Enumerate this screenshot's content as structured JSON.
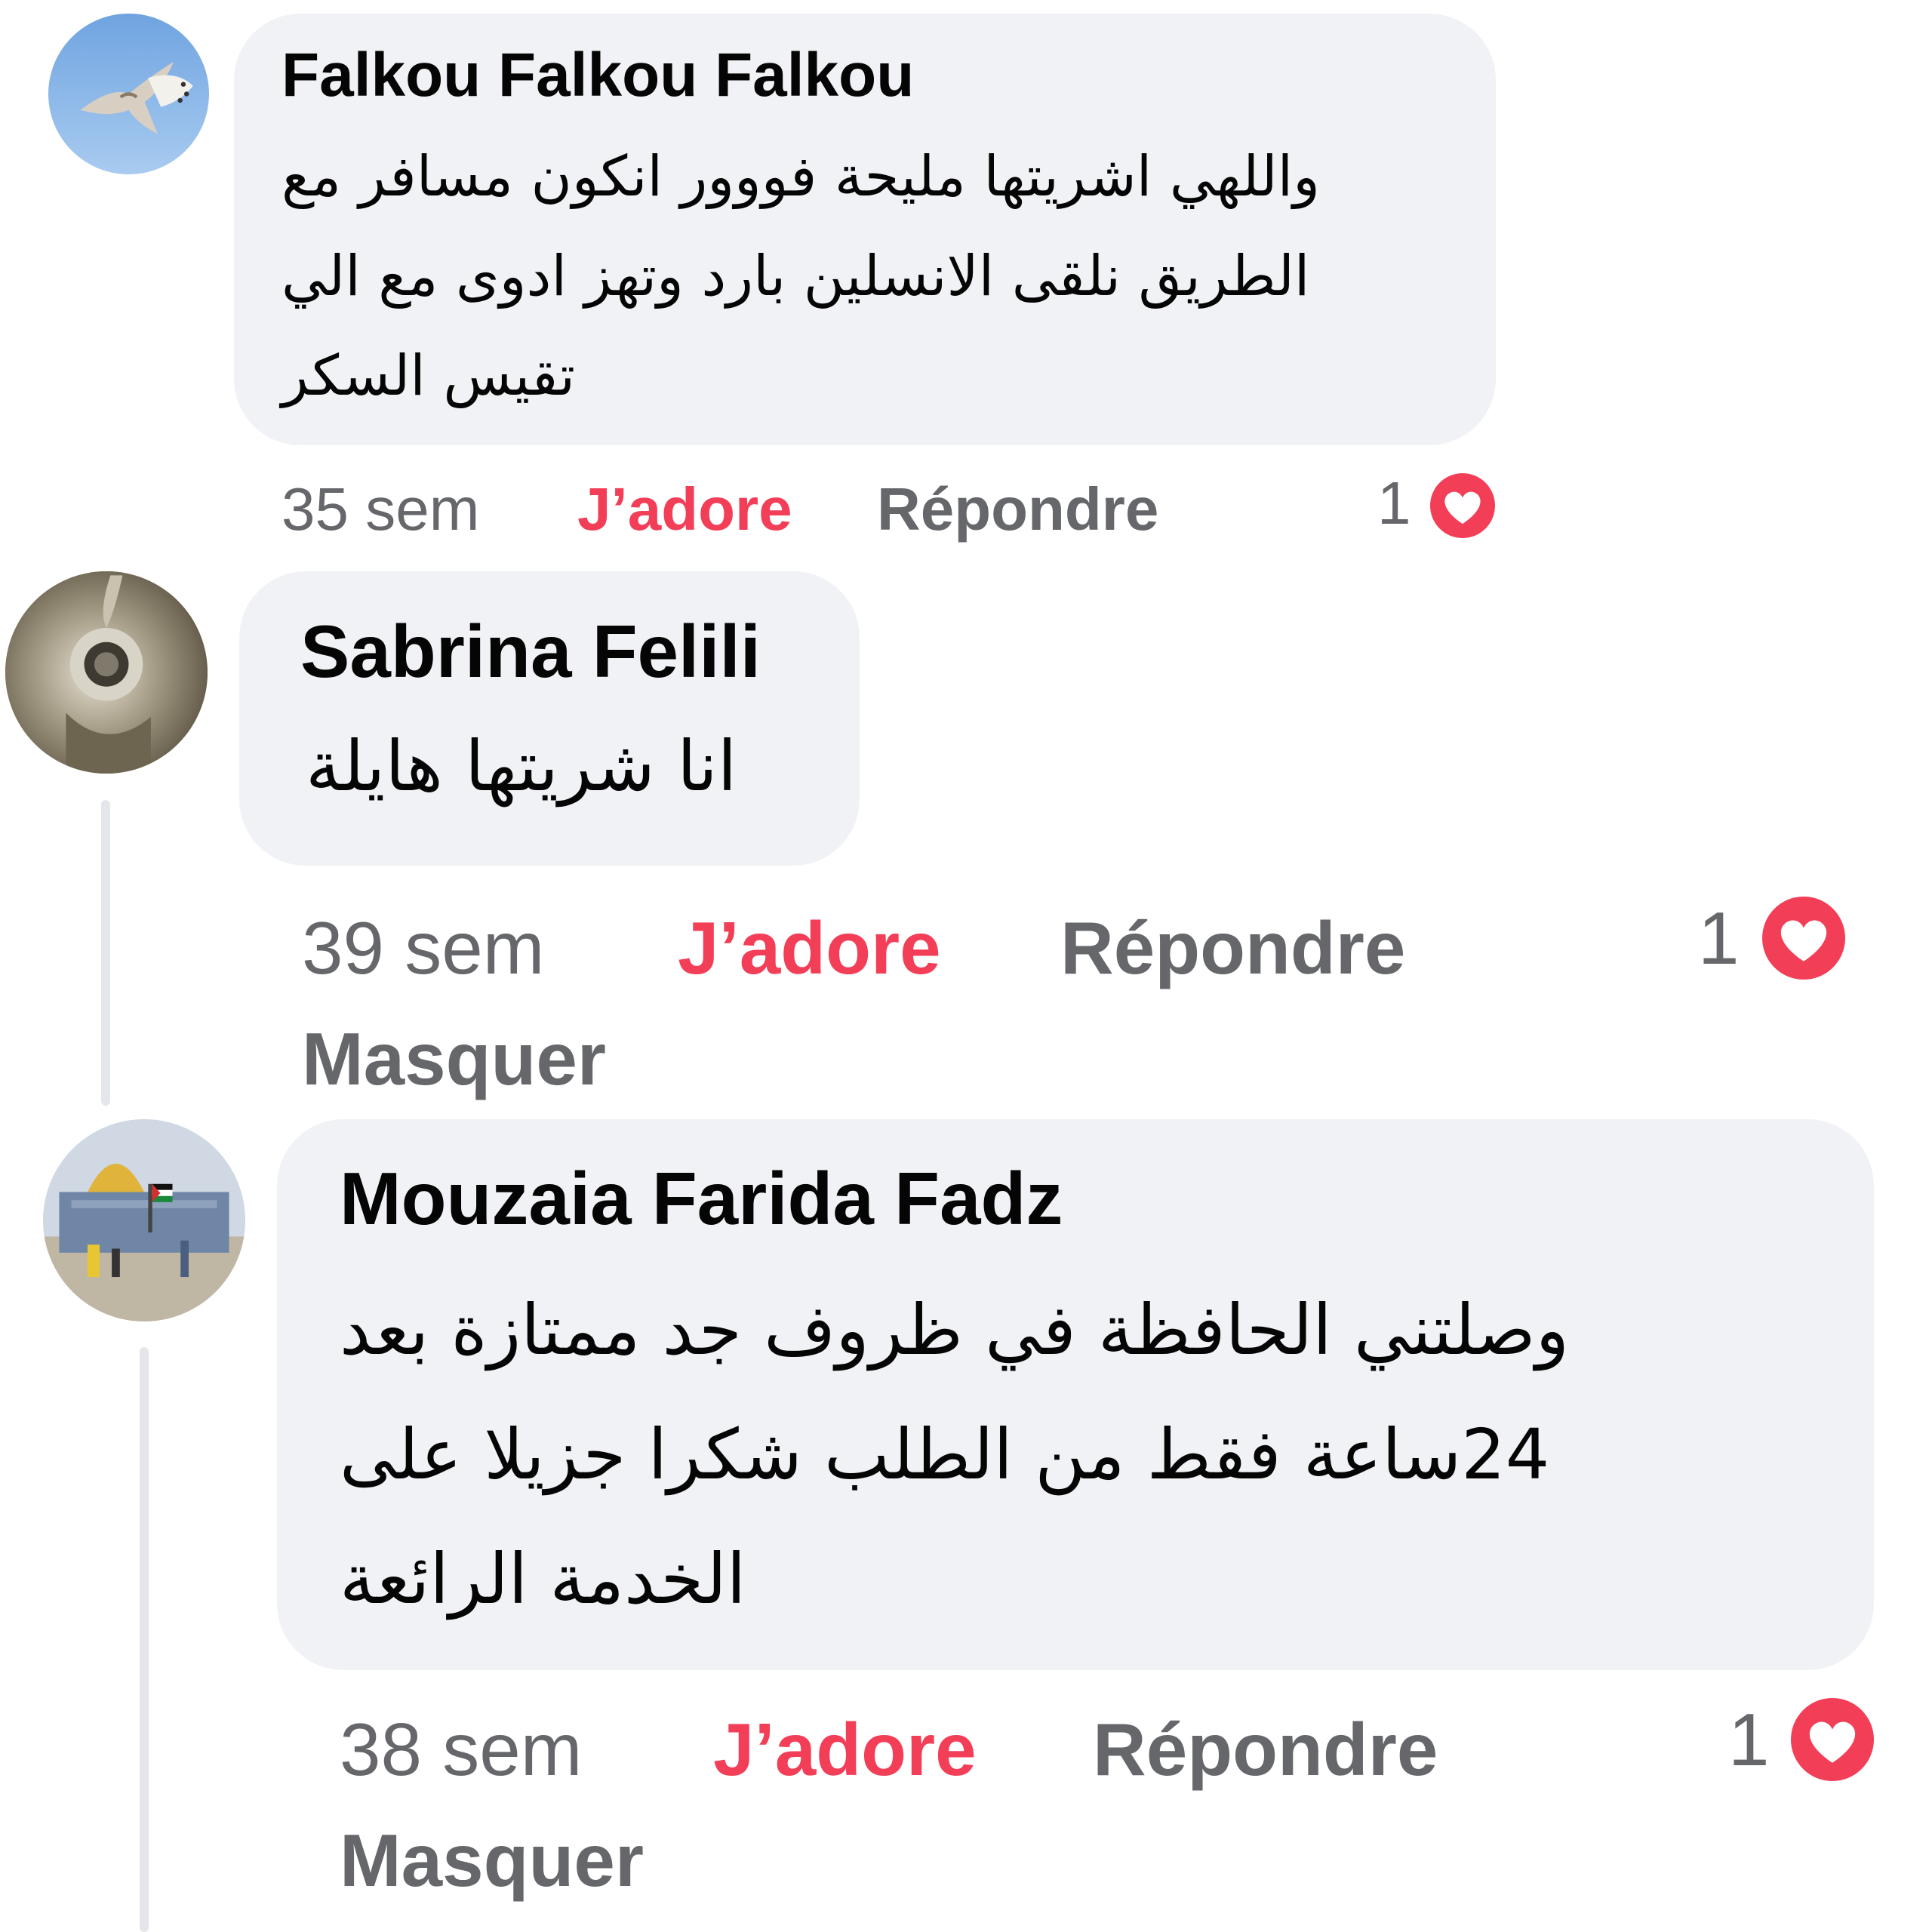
{
  "colors": {
    "bubble": "#f0f2f5",
    "like_active": "#f33e58",
    "meta_text": "#65676b",
    "name_text": "#050505",
    "thread_line": "#e4e6eb"
  },
  "comments": [
    {
      "author": "Falkou Falkou Falkou",
      "avatar_icon": "falcon-avatar",
      "text_lines": [
        "واللهي اشريتها مليحة فووور انكون مسافر مع",
        "الطريق نلقى الانسلين بارد وتهز ادوى مع الي",
        "تقيس السكر"
      ],
      "time": "35 sem",
      "like_label": "J’adore",
      "reply_label": "Répondre",
      "reaction_count": "1",
      "reaction_icon": "heart-icon"
    },
    {
      "author": "Sabrina Felili",
      "avatar_icon": "kettle-avatar",
      "text_lines": [
        "انا شريتها هايلة"
      ],
      "time": "39 sem",
      "like_label": "J’adore",
      "reply_label": "Répondre",
      "hide_label": "Masquer",
      "reaction_count": "1",
      "reaction_icon": "heart-icon"
    },
    {
      "author": "Mouzaia Farida Fadz",
      "avatar_icon": "dome-avatar",
      "text_lines": [
        "وصلتني الحافظة في ظروف جد ممتازة بعد",
        "24ساعة فقط من الطلب شكرا جزيلا على",
        "الخدمة الرائعة"
      ],
      "time": "38 sem",
      "like_label": "J’adore",
      "reply_label": "Répondre",
      "hide_label": "Masquer",
      "reaction_count": "1",
      "reaction_icon": "heart-icon"
    }
  ]
}
